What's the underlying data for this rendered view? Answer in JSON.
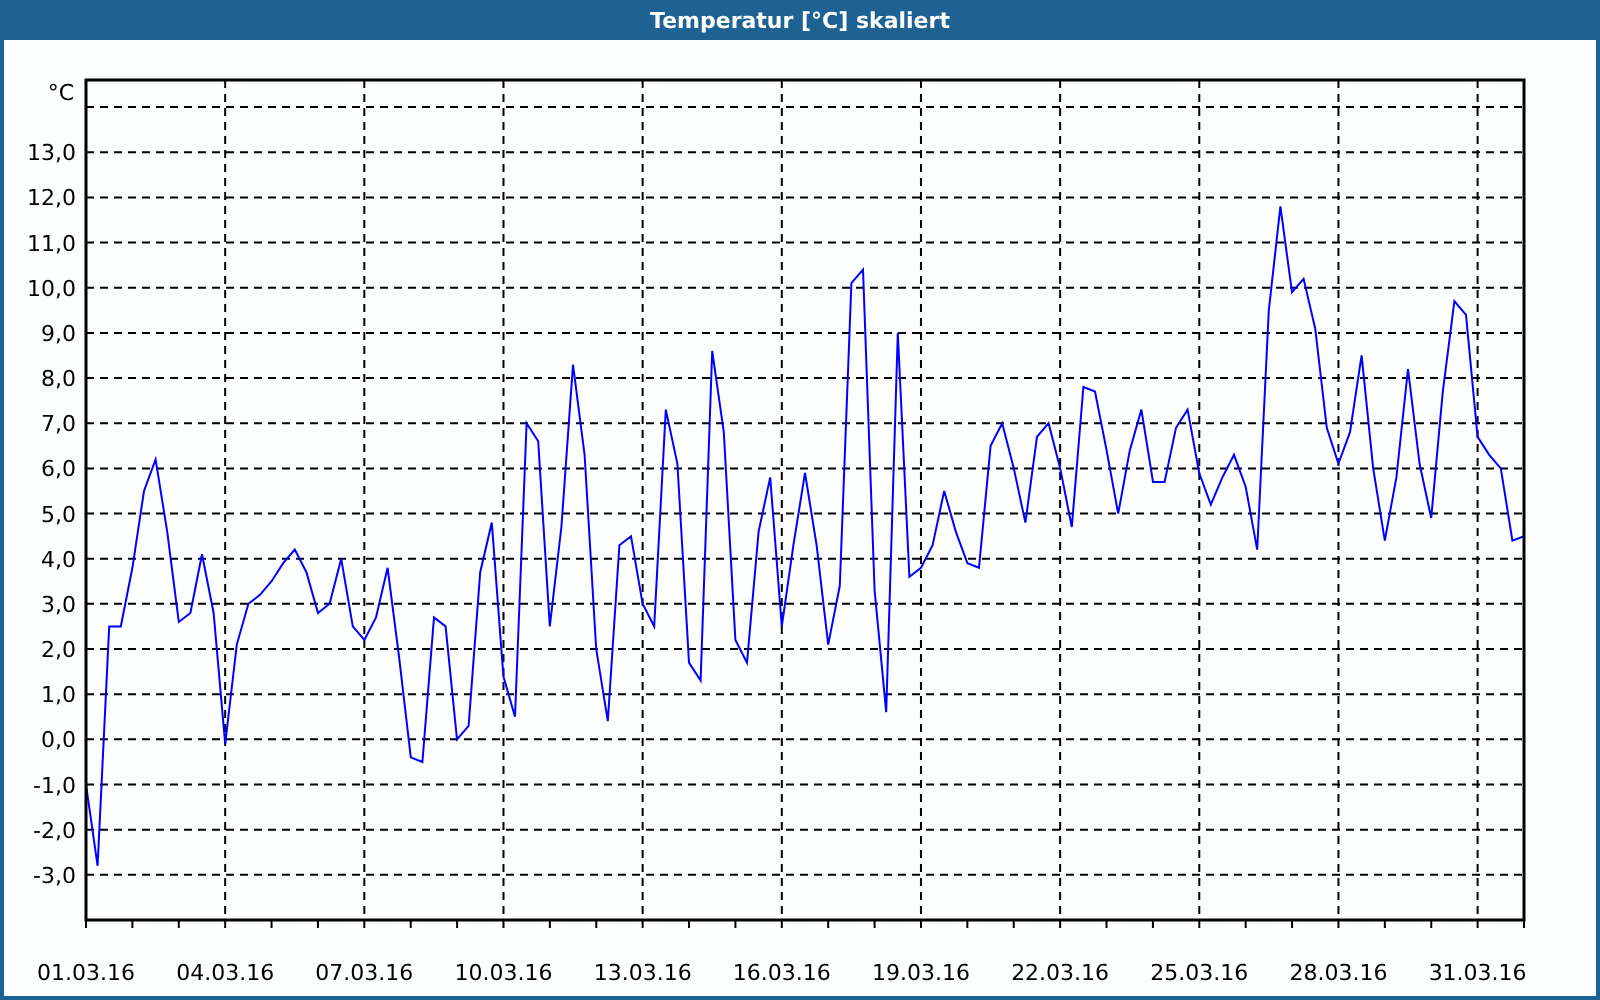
{
  "window": {
    "title": "Temperatur [°C] skaliert"
  },
  "chart_data": {
    "type": "line",
    "ylabel": "°C",
    "grid": true,
    "ylim": [
      -4,
      14.6
    ],
    "categories": [
      "01.03.16",
      null,
      null,
      null,
      null,
      null,
      null,
      null,
      null,
      null,
      null,
      null,
      "04.03.16",
      null,
      null,
      null,
      null,
      null,
      null,
      null,
      null,
      null,
      null,
      null,
      "07.03.16",
      null,
      null,
      null,
      null,
      null,
      null,
      null,
      null,
      null,
      null,
      null,
      "10.03.16",
      null,
      null,
      null,
      null,
      null,
      null,
      null,
      null,
      null,
      null,
      null,
      "13.03.16",
      null,
      null,
      null,
      null,
      null,
      null,
      null,
      null,
      null,
      null,
      null,
      "16.03.16",
      null,
      null,
      null,
      null,
      null,
      null,
      null,
      null,
      null,
      null,
      null,
      "19.03.16",
      null,
      null,
      null,
      null,
      null,
      null,
      null,
      null,
      null,
      null,
      null,
      "22.03.16",
      null,
      null,
      null,
      null,
      null,
      null,
      null,
      null,
      null,
      null,
      null,
      "25.03.16",
      null,
      null,
      null,
      null,
      null,
      null,
      null,
      null,
      null,
      null,
      null,
      "28.03.16",
      null,
      null,
      null,
      null,
      null,
      null,
      null,
      null,
      null,
      null,
      null,
      "31.03.16",
      null,
      null,
      null,
      null
    ],
    "yticks": [
      {
        "value": -3,
        "label": "-3,0"
      },
      {
        "value": -2,
        "label": "-2,0"
      },
      {
        "value": -1,
        "label": "-1,0"
      },
      {
        "value": 0,
        "label": "0,0"
      },
      {
        "value": 1,
        "label": "1,0"
      },
      {
        "value": 2,
        "label": "2,0"
      },
      {
        "value": 3,
        "label": "3,0"
      },
      {
        "value": 4,
        "label": "4,0"
      },
      {
        "value": 5,
        "label": "5,0"
      },
      {
        "value": 6,
        "label": "6,0"
      },
      {
        "value": 7,
        "label": "7,0"
      },
      {
        "value": 8,
        "label": "8,0"
      },
      {
        "value": 9,
        "label": "9,0"
      },
      {
        "value": 10,
        "label": "10,0"
      },
      {
        "value": 11,
        "label": "11,0"
      },
      {
        "value": 12,
        "label": "12,0"
      },
      {
        "value": 13,
        "label": "13,0"
      }
    ],
    "series": [
      {
        "color": "#0000ff",
        "values": [
          -1,
          -2.8,
          2.5,
          2.5,
          3.8,
          5.5,
          6.2,
          4.6,
          2.6,
          2.8,
          4.1,
          2.8,
          -0.1,
          2.1,
          3,
          3.2,
          3.5,
          3.9,
          4.2,
          3.7,
          2.8,
          3,
          4,
          2.5,
          2.2,
          2.7,
          3.8,
          1.8,
          -0.4,
          -0.5,
          2.7,
          2.5,
          0,
          0.3,
          3.7,
          4.8,
          1.4,
          0.5,
          7,
          6.6,
          2.5,
          4.7,
          8.3,
          6.3,
          2,
          0.4,
          4.3,
          4.5,
          3,
          2.5,
          7.3,
          6.1,
          1.7,
          1.3,
          8.6,
          6.8,
          2.2,
          1.7,
          4.6,
          5.8,
          2.5,
          4.3,
          5.9,
          4.3,
          2.1,
          3.4,
          10.1,
          10.4,
          3.3,
          0.6,
          9,
          3.6,
          3.8,
          4.3,
          5.5,
          4.6,
          3.9,
          3.8,
          6.5,
          7,
          6,
          4.8,
          6.7,
          7,
          6,
          4.7,
          7.8,
          7.7,
          6.4,
          5,
          6.4,
          7.3,
          5.7,
          5.7,
          6.9,
          7.3,
          5.9,
          5.2,
          5.8,
          6.3,
          5.6,
          4.2,
          9.5,
          11.8,
          9.9,
          10.2,
          9.1,
          6.9,
          6.1,
          6.8,
          8.5,
          6,
          4.4,
          5.8,
          8.2,
          6.1,
          4.9,
          7.7,
          9.7,
          9.4,
          6.7,
          6.3,
          6,
          4.4,
          4.5
        ]
      }
    ]
  }
}
